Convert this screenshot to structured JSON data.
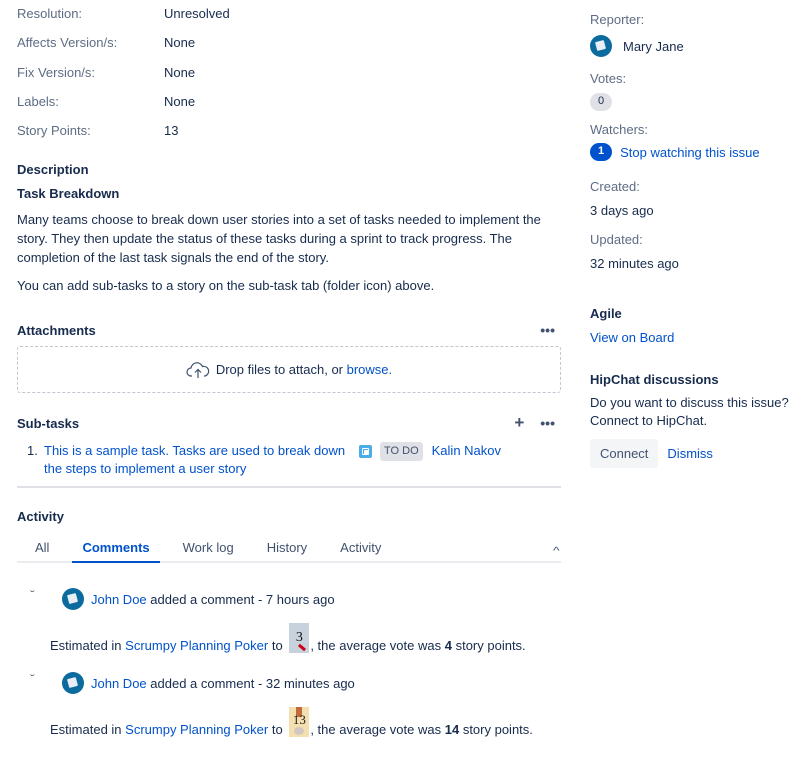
{
  "fields": [
    {
      "label": "Resolution:",
      "value": "Unresolved"
    },
    {
      "label": "Affects Version/s:",
      "value": "None"
    },
    {
      "label": "Fix Version/s:",
      "value": "None"
    },
    {
      "label": "Labels:",
      "value": "None"
    },
    {
      "label": "Story Points:",
      "value": "13"
    }
  ],
  "description": {
    "heading": "Description",
    "subheading": "Task Breakdown",
    "paragraphs": [
      "Many teams choose to break down user stories into a set of tasks needed to implement the story. They then update the status of these tasks during a sprint to track progress. The completion of the last task signals the end of the story.",
      "You can add sub-tasks to a story on the sub-task tab (folder icon) above."
    ]
  },
  "attachments": {
    "heading": "Attachments",
    "more_icon": "more-icon",
    "drop_text": "Drop files to attach, or ",
    "browse_link": "browse.",
    "icon": "cloud-upload-icon"
  },
  "subtasks": {
    "heading": "Sub-tasks",
    "add_icon": "plus-icon",
    "more_icon": "more-icon",
    "items": [
      {
        "number": "1.",
        "summary": "This is a sample task. Tasks are used to break down the steps to implement a user story",
        "type_icon": "subtask-icon",
        "status": "TO DO",
        "assignee": "Kalin Nakov"
      }
    ]
  },
  "activity": {
    "heading": "Activity",
    "tabs": [
      {
        "label": "All",
        "active": false
      },
      {
        "label": "Comments",
        "active": true
      },
      {
        "label": "Work log",
        "active": false
      },
      {
        "label": "History",
        "active": false
      },
      {
        "label": "Activity",
        "active": false
      }
    ],
    "comments": [
      {
        "author": "John Doe",
        "action": " added a comment - ",
        "time": "7 hours ago",
        "body_prefix": "Estimated in ",
        "body_link": "Scrumpy Planning Poker",
        "body_to": " to ",
        "card_value": "3",
        "body_mid": ", the average vote was ",
        "average": "4",
        "body_suffix": " story points."
      },
      {
        "author": "John Doe",
        "action": " added a comment - ",
        "time": "32 minutes ago",
        "body_prefix": "Estimated in ",
        "body_link": "Scrumpy Planning Poker",
        "body_to": " to ",
        "card_value": "13",
        "body_mid": ", the average vote was ",
        "average": "14",
        "body_suffix": " story points."
      }
    ]
  },
  "sidebar": {
    "reporter_label": "Reporter:",
    "reporter_name": "Mary Jane",
    "votes_label": "Votes:",
    "votes_count": "0",
    "watchers_label": "Watchers:",
    "watchers_count": "1",
    "watch_link": "Stop watching this issue",
    "created_label": "Created:",
    "created_value": "3 days ago",
    "updated_label": "Updated:",
    "updated_value": "32 minutes ago",
    "agile_heading": "Agile",
    "agile_link": "View on Board",
    "hipchat_heading": "HipChat discussions",
    "hipchat_text": "Do you want to discuss this issue? Connect to HipChat.",
    "connect_label": "Connect",
    "dismiss_label": "Dismiss"
  },
  "colors": {
    "link": "#0052cc",
    "text": "#172b4d",
    "muted": "#5e6c84",
    "watch_badge": "#0052cc"
  }
}
